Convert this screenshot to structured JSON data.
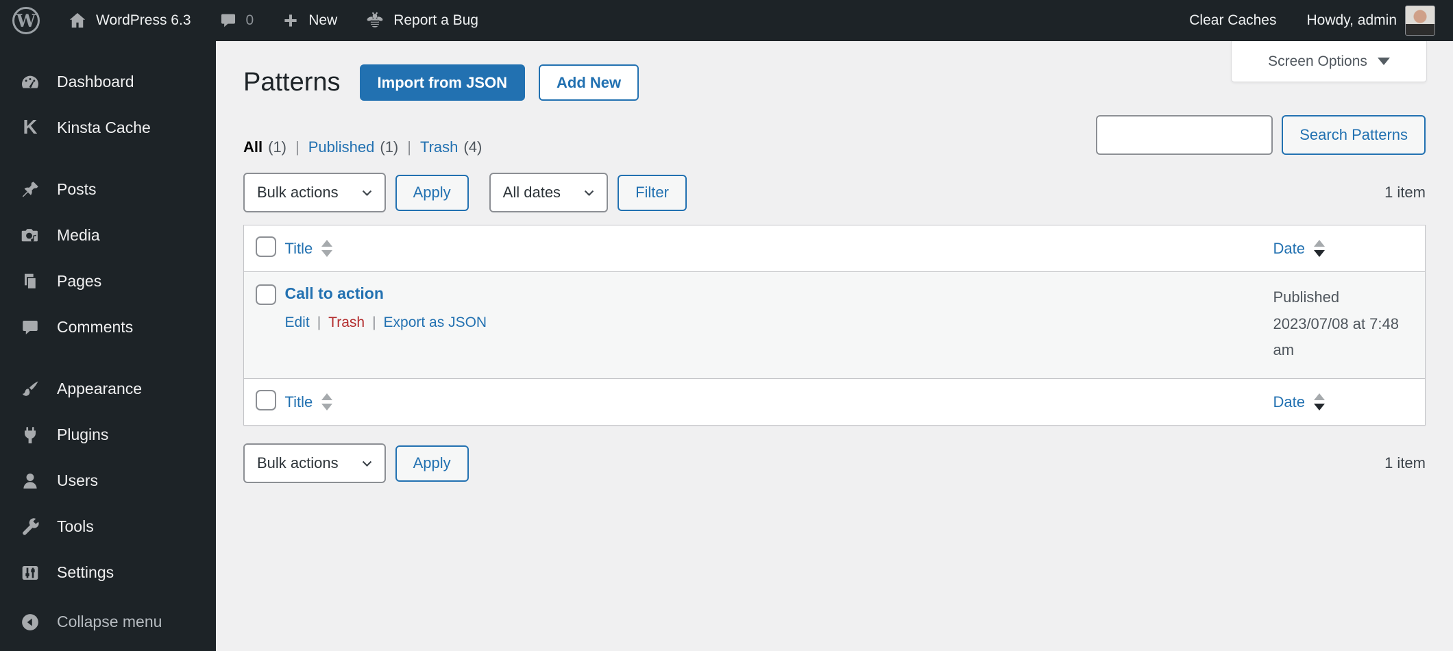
{
  "admin_bar": {
    "logo_letter": "W",
    "site_name": "WordPress 6.3",
    "comments_count": "0",
    "new_label": "New",
    "report_bug_label": "Report a Bug",
    "clear_caches_label": "Clear Caches",
    "howdy_label": "Howdy, admin"
  },
  "sidebar": {
    "items": [
      {
        "label": "Dashboard",
        "icon": "dashboard-icon"
      },
      {
        "label": "Kinsta Cache",
        "icon": "kinsta-icon",
        "icon_letter": "K"
      },
      {
        "label": "Posts",
        "icon": "pushpin-icon"
      },
      {
        "label": "Media",
        "icon": "camera-icon"
      },
      {
        "label": "Pages",
        "icon": "pages-icon"
      },
      {
        "label": "Comments",
        "icon": "comment-icon"
      },
      {
        "label": "Appearance",
        "icon": "brush-icon"
      },
      {
        "label": "Plugins",
        "icon": "plug-icon"
      },
      {
        "label": "Users",
        "icon": "user-icon"
      },
      {
        "label": "Tools",
        "icon": "wrench-icon"
      },
      {
        "label": "Settings",
        "icon": "sliders-icon"
      }
    ],
    "collapse_label": "Collapse menu"
  },
  "screen_options": {
    "label": "Screen Options"
  },
  "page": {
    "title": "Patterns",
    "import_json_button": "Import from JSON",
    "add_new_button": "Add New",
    "sep": "|",
    "filters": [
      {
        "label": "All",
        "count": "(1)",
        "active": true
      },
      {
        "label": "Published",
        "count": "(1)",
        "active": false
      },
      {
        "label": "Trash",
        "count": "(4)",
        "active": false
      }
    ],
    "search": {
      "value": "",
      "button_label": "Search Patterns"
    },
    "toolbar": {
      "bulk_actions_label": "Bulk actions",
      "apply_label": "Apply",
      "all_dates_label": "All dates",
      "filter_label": "Filter"
    },
    "item_count": "1 item",
    "table": {
      "headers": {
        "title": "Title",
        "date": "Date"
      },
      "sort": {
        "title": "none",
        "date": "desc"
      },
      "rows": [
        {
          "title": "Call to action",
          "actions": [
            {
              "label": "Edit"
            },
            {
              "label": "Trash"
            },
            {
              "label": "Export as JSON"
            }
          ],
          "status": "Published",
          "date": "2023/07/08 at 7:48 am"
        }
      ]
    }
  },
  "colors": {
    "accent_blue": "#2271b1",
    "danger_red": "#b32d2e",
    "chrome_dark": "#1d2327",
    "content_bg": "#f0f0f1",
    "row_stripe": "#f6f7f7"
  }
}
